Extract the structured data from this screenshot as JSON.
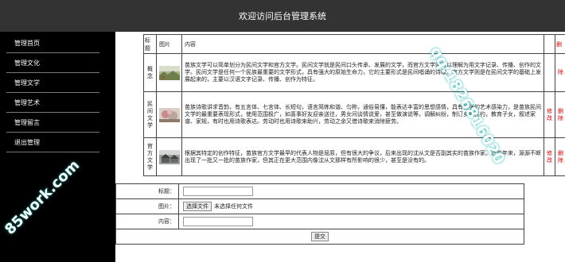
{
  "header": {
    "title": "欢迎访问后台管理系统"
  },
  "sidebar": {
    "items": [
      {
        "label": "管理首页"
      },
      {
        "label": "管理文化"
      },
      {
        "label": "管理文学"
      },
      {
        "label": "管理艺术"
      },
      {
        "label": "管理留言"
      },
      {
        "label": "退出管理"
      }
    ]
  },
  "table": {
    "headers": {
      "title": "标题",
      "picture": "图片",
      "content": "内容",
      "op1": "",
      "op2": "删"
    },
    "rows": [
      {
        "title": "概念",
        "content": "苗族文学可以简单划分为民间文学和官方文学。民间文学就是民间口头传承、发展的文学，而官方文学则可以理解为用文字记录、传播、创作的文学。民间文学是任何一个民族最重要的文学形式，具有强大的原始生命力，它的主要形式是民间唱诵的诗歌。官方文学则是在民间文学的基础上发展起来的，主要以汉语文字记录、传播、创作为特征。",
        "edit": "",
        "delete": "除"
      },
      {
        "title": "民间文学",
        "content": "苗族诗歌讲求音韵，有五言体、七言体、长短句，语言简练和谐、匀称，通俗易懂，能表达丰富的思想感情，具有很强的艺术感染力，是苗族民间文学的最重要表现形式，使用范围极广，如喜事好友迎亲送往，男女间谈情说爱，甚至做演说等，调解纠纷，制订乡规民约，教育子女，叙述家谱、家规，有时也用诗歌表达。劳动时也用诗歌来助兴，劳动之余又借诗歌来消除疲劳。",
        "edit": "修改",
        "delete": "删除"
      },
      {
        "title": "官方文学",
        "content": "根据其特定的创作特征，苗族官方文学最早的代表人物是屈原，但有很大的争议，后来出现的沈从文是否副其实的苗族作家。近些年来，源源不断出现了一批又一批的苗族作家，但其正在更大范围内像沈从文那样有所影响的很少，甚至是没有的。",
        "edit": "修改",
        "delete": "删除"
      }
    ]
  },
  "form": {
    "title_label": "标题：",
    "image_label": "图片：",
    "file_button": "选择文件",
    "file_status": "未选择任何文件",
    "content_label": "内容：",
    "submit_label": "提交"
  },
  "watermarks": {
    "qq": "qq:1826816020",
    "site": "85work.com"
  },
  "colors": {
    "header_bg": "#333333",
    "sidebar_bg": "#000000",
    "op_link": "#cc0000",
    "watermark_glow": "#11aaaa"
  },
  "icons": [
    "landscape-thumbnail",
    "blossom-thumbnail",
    "village-thumbnail"
  ]
}
